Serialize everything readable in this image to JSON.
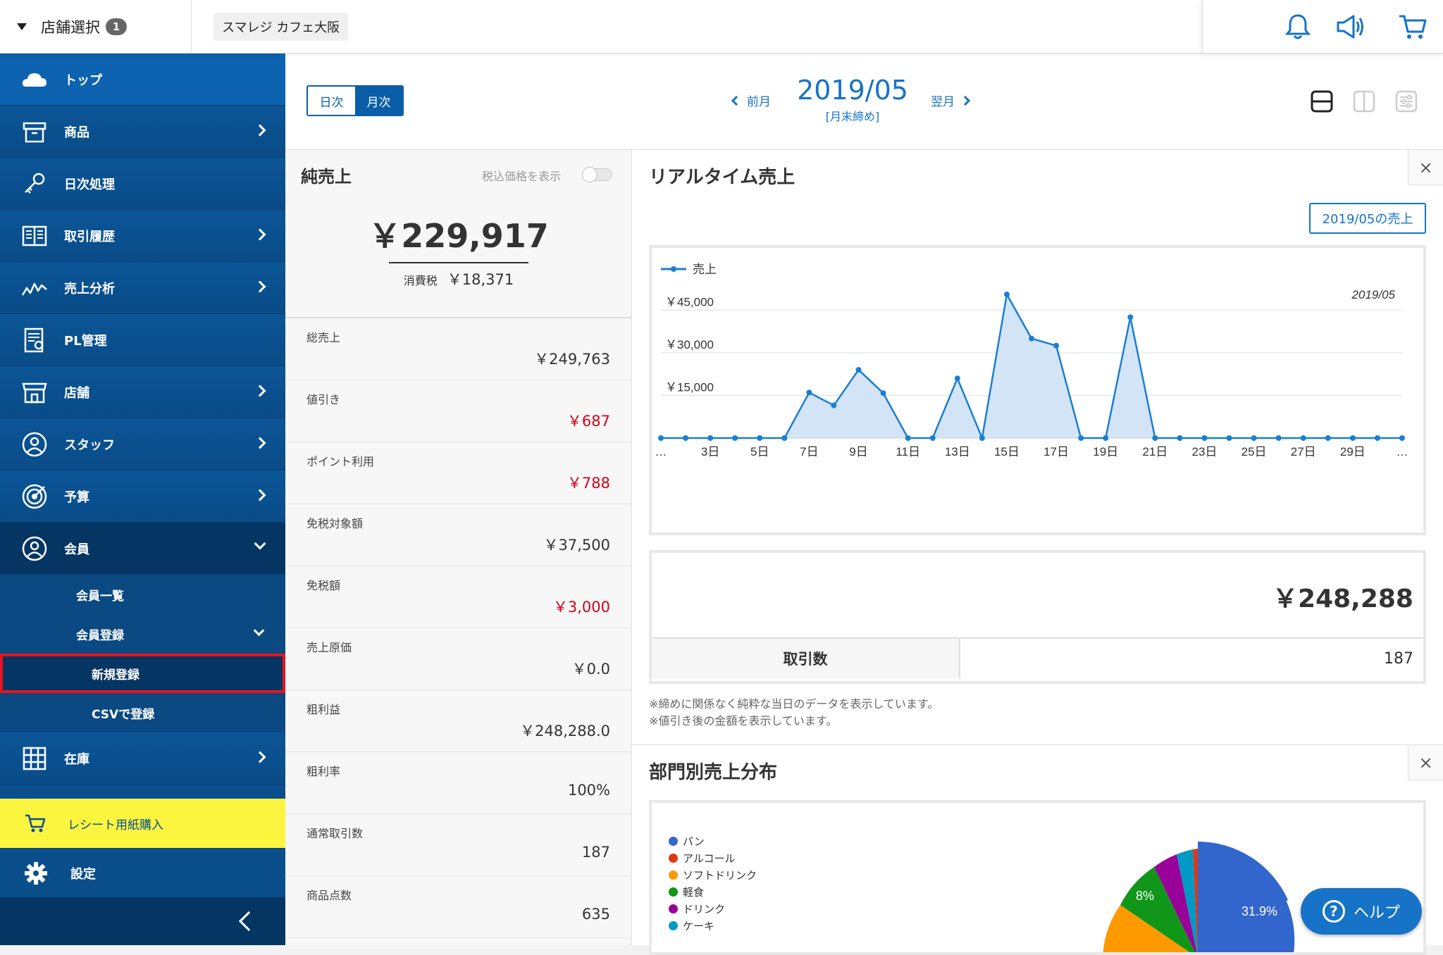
{
  "topbar": {
    "store_select_label": "店舗選択",
    "store_count": "1",
    "store_name": "スマレジ カフェ大阪",
    "icons": [
      "bell-icon",
      "megaphone-icon",
      "cart-icon"
    ]
  },
  "sidebar": {
    "items": [
      {
        "label": "トップ",
        "icon": "cloud-icon"
      },
      {
        "label": "商品",
        "icon": "box-icon"
      },
      {
        "label": "日次処理",
        "icon": "key-icon"
      },
      {
        "label": "取引履歴",
        "icon": "book-icon"
      },
      {
        "label": "売上分析",
        "icon": "chart-line-icon"
      },
      {
        "label": "PL管理",
        "icon": "report-icon"
      },
      {
        "label": "店舗",
        "icon": "store-icon"
      },
      {
        "label": "スタッフ",
        "icon": "staff-icon"
      },
      {
        "label": "予算",
        "icon": "target-icon"
      },
      {
        "label": "会員",
        "icon": "member-icon"
      },
      {
        "label": "在庫",
        "icon": "grid-icon"
      }
    ],
    "member_sub": {
      "list": "会員一覧",
      "register": "会員登録",
      "new": "新規登録",
      "csv": "CSVで登録"
    },
    "receipt": "レシート用紙購入",
    "settings": "設定"
  },
  "header": {
    "day": "日次",
    "month": "月次",
    "prev": "前月",
    "next": "翌月",
    "period": "2019/05",
    "period_note": "[月末締め]"
  },
  "net_sales": {
    "title": "純売上",
    "tax_toggle_label": "税込価格を表示",
    "tax_toggle_on": false,
    "value": "￥229,917",
    "tax_label": "消費税",
    "tax_value": "￥18,371",
    "rows": [
      {
        "label": "総売上",
        "value": "￥249,763",
        "red": false
      },
      {
        "label": "値引き",
        "value": "￥687",
        "red": true
      },
      {
        "label": "ポイント利用",
        "value": "￥788",
        "red": true
      },
      {
        "label": "免税対象額",
        "value": "￥37,500",
        "red": false
      },
      {
        "label": "免税額",
        "value": "￥3,000",
        "red": true
      },
      {
        "label": "売上原価",
        "value": "￥0.0",
        "red": false
      },
      {
        "label": "粗利益",
        "value": "￥248,288.0",
        "red": false
      },
      {
        "label": "粗利率",
        "value": "100%",
        "red": false
      },
      {
        "label": "通常取引数",
        "value": "187",
        "red": false
      },
      {
        "label": "商品点数",
        "value": "635",
        "red": false
      }
    ]
  },
  "realtime": {
    "title": "リアルタイム売上",
    "close": "×",
    "month_button": "2019/05の売上",
    "total": "￥248,288",
    "trx_label": "取引数",
    "trx_value": "187",
    "note1": "※締めに関係なく純粋な当日のデータを表示しています。",
    "note2": "※値引き後の金額を表示しています。"
  },
  "chart_data": {
    "type": "area",
    "title": "",
    "subtitle": "2019/05",
    "legend": [
      "売上"
    ],
    "legend_position": "top-left",
    "x_tick_labels": [
      "…",
      "3日",
      "5日",
      "7日",
      "9日",
      "11日",
      "13日",
      "15日",
      "17日",
      "19日",
      "21日",
      "23日",
      "25日",
      "27日",
      "29日",
      "…"
    ],
    "y_tick_labels": [
      "￥15,000",
      "￥30,000",
      "￥45,000"
    ],
    "ylim": [
      0,
      52000
    ],
    "grid": true,
    "color": "#1a7fd0",
    "fill": "#d4e4f7",
    "series": [
      {
        "name": "売上",
        "x": [
          1,
          2,
          3,
          4,
          5,
          6,
          7,
          8,
          9,
          10,
          11,
          12,
          13,
          14,
          15,
          16,
          17,
          18,
          19,
          20,
          21,
          22,
          23,
          24,
          25,
          26,
          27,
          28,
          29,
          30,
          31
        ],
        "values": [
          0,
          0,
          0,
          0,
          0,
          0,
          16000,
          11500,
          24000,
          15800,
          0,
          0,
          21000,
          0,
          50500,
          35000,
          32500,
          0,
          0,
          42500,
          0,
          0,
          0,
          0,
          0,
          0,
          0,
          0,
          0,
          0,
          0
        ]
      }
    ]
  },
  "dept": {
    "title": "部門別売上分布",
    "close": "×",
    "legend": [
      {
        "label": "パン",
        "color": "#3366cc"
      },
      {
        "label": "アルコール",
        "color": "#dc3912"
      },
      {
        "label": "ソフトドリンク",
        "color": "#ff9900"
      },
      {
        "label": "軽食",
        "color": "#109618"
      },
      {
        "label": "ドリンク",
        "color": "#990099"
      },
      {
        "label": "ケーキ",
        "color": "#0099c6"
      }
    ],
    "slice_labels": [
      "31.9%",
      "8%"
    ]
  },
  "help": "ヘルプ"
}
